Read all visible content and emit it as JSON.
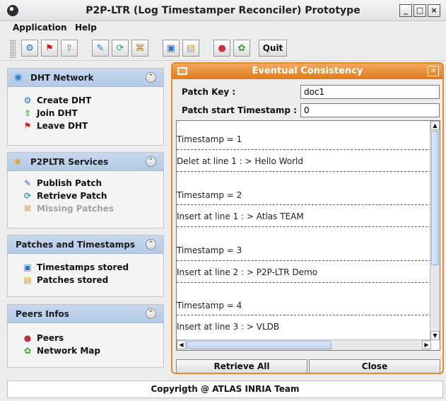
{
  "window": {
    "title": "P2P-LTR (Log Timestamper Reconciler) Prototype",
    "controls": [
      "_",
      "□",
      "×"
    ]
  },
  "menu": {
    "application": "Application",
    "help": "Help"
  },
  "toolbar": {
    "buttons": [
      "create-dht",
      "leave-dht",
      "join-dht",
      "publish-patch",
      "retrieve-patch",
      "missing-patches",
      "timestamps-stored",
      "patches-stored",
      "peers",
      "network-map"
    ],
    "quit_label": "Quit"
  },
  "sidebar": {
    "dht": {
      "title": "DHT Network",
      "items": [
        "Create DHT",
        "Join DHT",
        "Leave DHT"
      ]
    },
    "services": {
      "title": "P2PLTR Services",
      "items": [
        "Publish Patch",
        "Retrieve Patch",
        "Missing Patches"
      ]
    },
    "patches": {
      "title": "Patches and Timestamps",
      "items": [
        "Timestamps stored",
        "Patches stored"
      ]
    },
    "peers": {
      "title": "Peers Infos",
      "items": [
        "Peers",
        "Network Map"
      ]
    }
  },
  "dialog": {
    "title": "Eventual Consistency",
    "patch_key_label": "Patch Key :",
    "patch_key_value": "doc1",
    "patch_ts_label": "Patch start Timestamp :",
    "patch_ts_value": "0",
    "log": [
      "Timestamp = 1",
      "Delet at line 1 : > Hello World",
      "Timestamp = 2",
      "Insert at line 1 : > Atlas TEAM",
      "Timestamp = 3",
      "Insert at line 2 : > P2P-LTR Demo",
      "Timestamp = 4",
      "Insert at line 3 : > VLDB"
    ],
    "retrieve_all_label": "Retrieve All",
    "close_label": "Close"
  },
  "status": {
    "text": "Copyrigth @ ATLAS INRIA Team"
  },
  "colors": {
    "panel_header": "#b9cde8",
    "dialog_title": "#e8852a",
    "disabled_text": "#a3a3a3"
  }
}
